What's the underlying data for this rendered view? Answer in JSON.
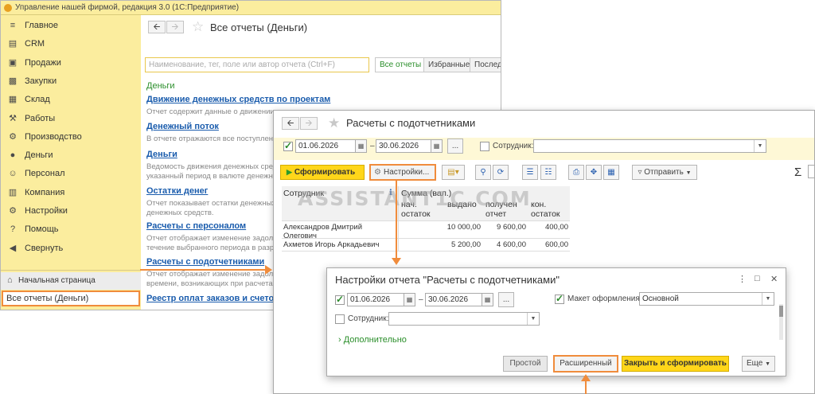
{
  "app_window": {
    "title": "Управление нашей фирмой, редакция 3.0  (1С:Предприятие)",
    "sidebar": {
      "items": [
        {
          "label": "Главное",
          "icon": "menu-icon",
          "glyph": "≡"
        },
        {
          "label": "CRM",
          "icon": "crm-icon",
          "glyph": "▤"
        },
        {
          "label": "Продажи",
          "icon": "sales-icon",
          "glyph": "▣"
        },
        {
          "label": "Закупки",
          "icon": "purchases-icon",
          "glyph": "▩"
        },
        {
          "label": "Склад",
          "icon": "warehouse-icon",
          "glyph": "▦"
        },
        {
          "label": "Работы",
          "icon": "works-icon",
          "glyph": "⚒"
        },
        {
          "label": "Производство",
          "icon": "production-icon",
          "glyph": "⚙"
        },
        {
          "label": "Деньги",
          "icon": "money-icon",
          "glyph": "●"
        },
        {
          "label": "Персонал",
          "icon": "staff-icon",
          "glyph": "☺"
        },
        {
          "label": "Компания",
          "icon": "company-icon",
          "glyph": "▥"
        },
        {
          "label": "Настройки",
          "icon": "settings-icon",
          "glyph": "⚙"
        },
        {
          "label": "Помощь",
          "icon": "help-icon",
          "glyph": "?"
        },
        {
          "label": "Свернуть",
          "icon": "collapse-icon",
          "glyph": "◀"
        }
      ],
      "home": "Начальная страница",
      "current": "Все отчеты (Деньги)"
    },
    "page_title": "Все отчеты (Деньги)",
    "search_placeholder": "Наименование, тег, поле или автор отчета (Ctrl+F)",
    "tabs": [
      "Все отчеты",
      "Избранные",
      "Послед"
    ],
    "category": "Деньги",
    "reports": [
      {
        "title": "Движение денежных средств по проектам",
        "desc": [
          "Отчет содержит данные о движении денежных средств"
        ]
      },
      {
        "title": "Денежный поток",
        "desc": [
          "В отчете отражаются все поступлени"
        ]
      },
      {
        "title": "Деньги",
        "desc": [
          "Ведомость движения денежных средс",
          "указанный период в валюте денежны"
        ]
      },
      {
        "title": "Остатки денег",
        "desc": [
          "Отчет показывает остатки денежных с",
          "денежных средств."
        ]
      },
      {
        "title": "Расчеты с персоналом",
        "desc": [
          "Отчет отображает изменение задолже",
          "течение выбранного периода в разре"
        ]
      },
      {
        "title": "Расчеты с подотчетниками",
        "desc": [
          "Отчет отображает изменение задолже",
          "времени, возникающих при расчетах с"
        ]
      },
      {
        "title": "Реестр оплат заказов и счетов",
        "desc": []
      }
    ]
  },
  "report_window": {
    "title": "Расчеты с подотчетниками",
    "date_from": "01.06.2026",
    "date_sep": "–",
    "date_to": "30.06.2026",
    "period_button": "...",
    "employee_label": "Сотрудник:",
    "employee_value": "",
    "generate_button": "Сформировать",
    "settings_button": "Настройки...",
    "send_button": "Отправить",
    "sigma": "Σ",
    "table": {
      "col_employee": "Сотрудник",
      "col_sum": "Сумма (вал.)",
      "col_start": "нач. остаток",
      "col_issued": "выдано",
      "col_received": "получен отчет",
      "col_end": "кон. остаток",
      "rows": [
        {
          "employee": "Александров Дмитрий Олегович",
          "start": "",
          "issued": "10 000,00",
          "received": "9 600,00",
          "end": "400,00"
        },
        {
          "employee": "Ахметов Игорь Аркадьевич",
          "start": "",
          "issued": "5 200,00",
          "received": "4 600,00",
          "end": "600,00"
        }
      ]
    },
    "watermark": "ASSISTANT1C.COM"
  },
  "settings_dialog": {
    "title": "Настройки отчета \"Расчеты с подотчетниками\"",
    "date_from": "01.06.2026",
    "date_sep": "–",
    "date_to": "30.06.2026",
    "period_button": "...",
    "employee_label": "Сотрудник:",
    "layout_label": "Макет оформления:",
    "layout_value": "Основной",
    "more_link": "Дополнительно",
    "btn_simple": "Простой",
    "btn_advanced": "Расширенный",
    "btn_close_generate": "Закрыть и сформировать",
    "btn_more": "Еще"
  },
  "colors": {
    "accent_yellow": "#ffd61a",
    "sidebar_bg": "#fbed9e",
    "link_blue": "#1a5cad",
    "highlight_orange": "#f08c3c",
    "green": "#2a8e2a"
  }
}
